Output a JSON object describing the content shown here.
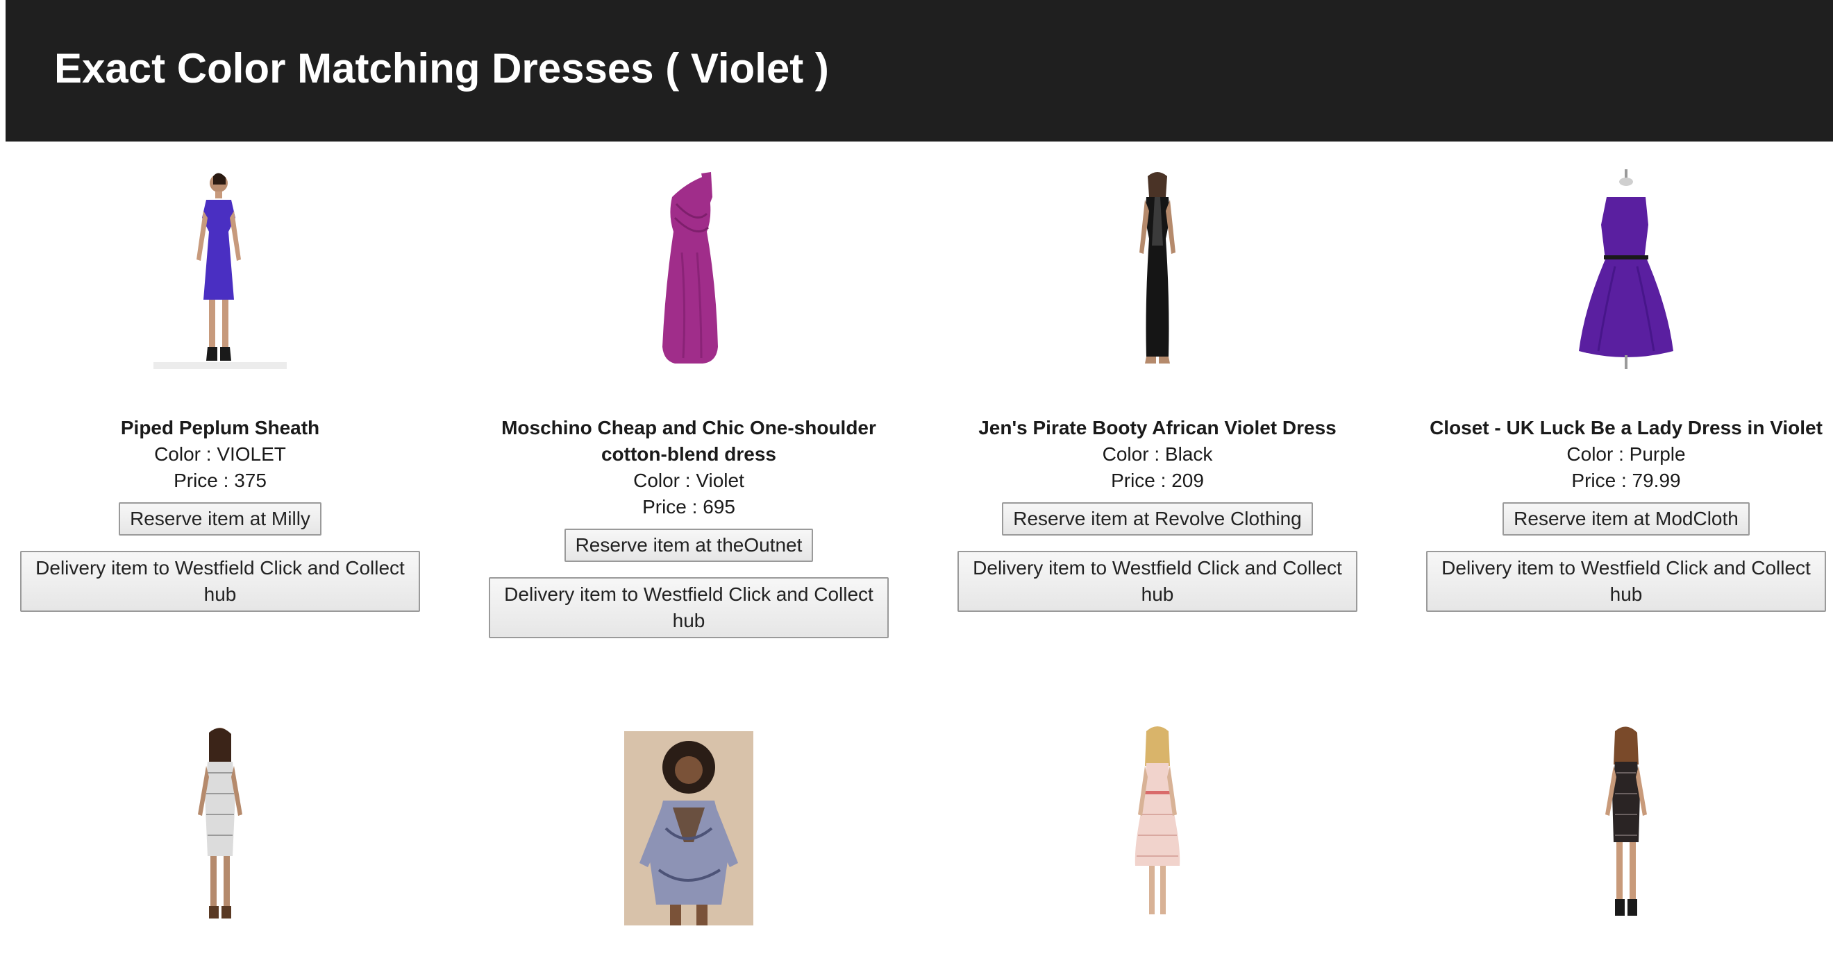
{
  "page": {
    "title": "Exact Color Matching Dresses ( Violet )"
  },
  "products": [
    {
      "name": "Piped Peplum Sheath",
      "color_label": "Color : VIOLET",
      "price_label": "Price : 375",
      "reserve_label": "Reserve item at Milly",
      "delivery_label": "Delivery item to Westfield Click and Collect hub",
      "image_icon": "dress-photo",
      "dress_color": "#4a2fc2"
    },
    {
      "name": "Moschino Cheap and Chic One-shoulder cotton-blend dress",
      "color_label": "Color : Violet",
      "price_label": "Price : 695",
      "reserve_label": "Reserve item at theOutnet",
      "delivery_label": "Delivery item to Westfield Click and Collect hub",
      "image_icon": "dress-photo",
      "dress_color": "#a02d8a"
    },
    {
      "name": "Jen's Pirate Booty African Violet Dress",
      "color_label": "Color : Black",
      "price_label": "Price : 209",
      "reserve_label": "Reserve item at Revolve Clothing",
      "delivery_label": "Delivery item to Westfield Click and Collect hub",
      "image_icon": "dress-photo",
      "dress_color": "#151515"
    },
    {
      "name": "Closet - UK Luck Be a Lady Dress in Violet",
      "color_label": "Color : Purple",
      "price_label": "Price : 79.99",
      "reserve_label": "Reserve item at ModCloth",
      "delivery_label": "Delivery item to Westfield Click and Collect hub",
      "image_icon": "dress-photo",
      "dress_color": "#5a1fa0"
    },
    {
      "image_icon": "dress-photo",
      "dress_color": "#dcdcdc"
    },
    {
      "image_icon": "dress-photo",
      "dress_color": "#8d93b5"
    },
    {
      "image_icon": "dress-photo",
      "dress_color": "#f1d3cc"
    },
    {
      "image_icon": "dress-photo",
      "dress_color": "#2a2424"
    }
  ]
}
